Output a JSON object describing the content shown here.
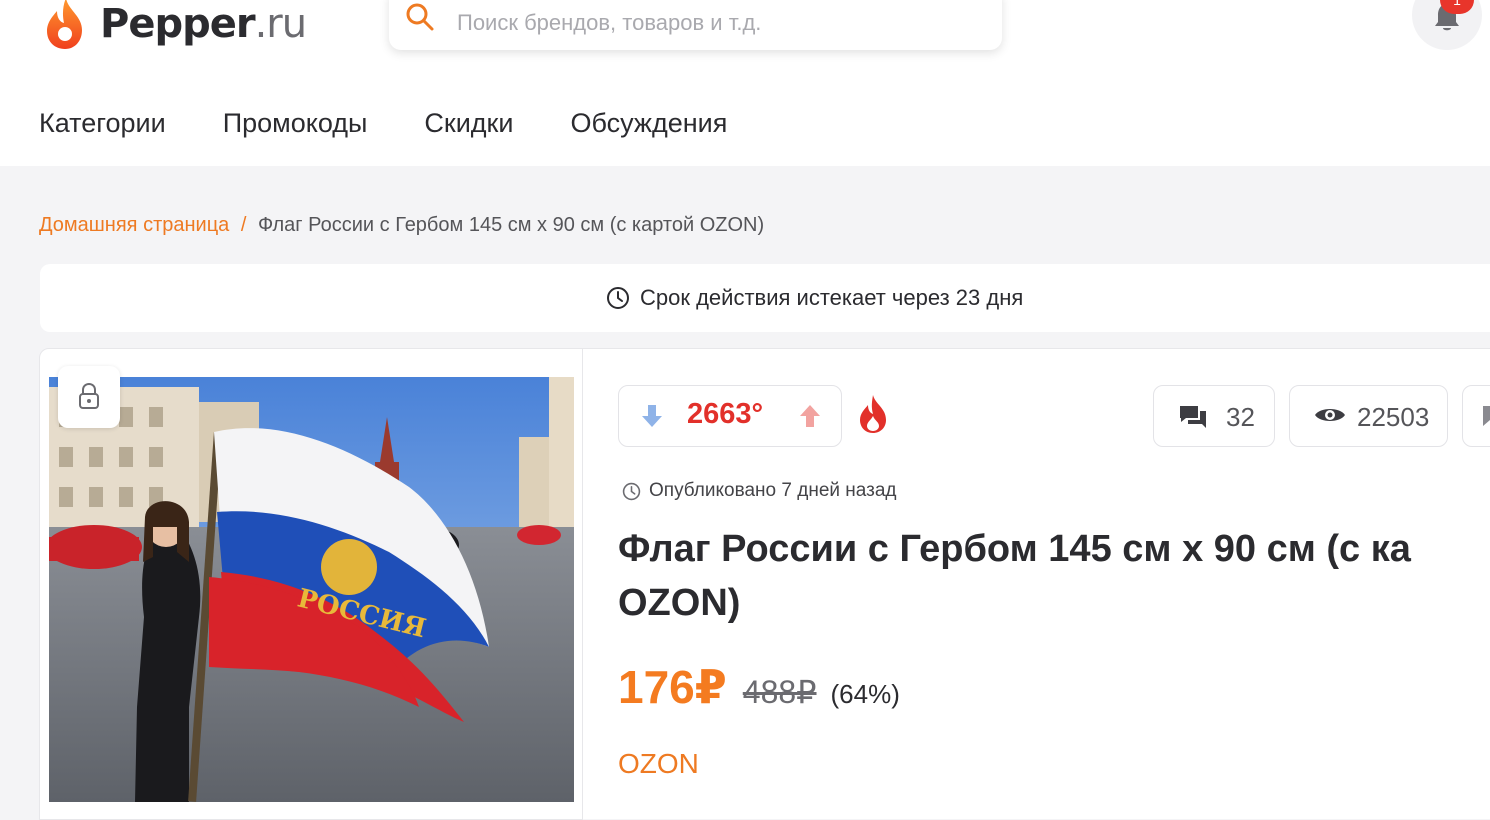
{
  "header": {
    "logo_name": "Pepper",
    "logo_suffix": ".ru",
    "search_placeholder": "Поиск брендов, товаров и т.д.",
    "notifications_count": "1"
  },
  "nav": {
    "items": [
      {
        "label": "Категории"
      },
      {
        "label": "Промокоды"
      },
      {
        "label": "Скидки"
      },
      {
        "label": "Обсуждения"
      }
    ]
  },
  "breadcrumb": {
    "home": "Домашняя страница",
    "separator": "/",
    "current": "Флаг России с Гербом 145 см x 90 см (с картой OZON)"
  },
  "expiry": {
    "text": "Срок действия истекает через 23 дня",
    "icon": "clock-icon"
  },
  "deal": {
    "temperature": "2663°",
    "comments_count": "32",
    "views_count": "22503",
    "published": "Опубликовано 7 дней назад",
    "title_line1": "Флаг России с Гербом 145 см x 90 см (с ка",
    "title_line2": "OZON)",
    "price_new": "176₽",
    "price_old": "488₽",
    "discount": "(64%)",
    "merchant": "OZON",
    "image_flag_text": "РОССИЯ"
  },
  "colors": {
    "accent": "#ee7a22",
    "hot": "#e2302a",
    "price": "#f47b20",
    "vote_down": "#8fb3e8",
    "vote_up": "#f2a3a0"
  }
}
